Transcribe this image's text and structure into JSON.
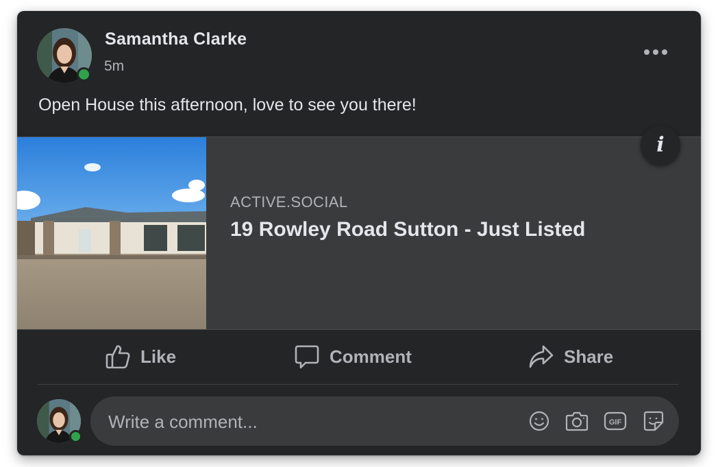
{
  "post": {
    "author_name": "Samantha Clarke",
    "timestamp": "5m",
    "text": "Open House this afternoon, love to see you there!",
    "online_color": "#31a24c"
  },
  "link": {
    "domain": "ACTIVE.SOCIAL",
    "title": "19 Rowley Road Sutton - Just Listed",
    "info_icon": "info-icon"
  },
  "actions": {
    "like_label": "Like",
    "comment_label": "Comment",
    "share_label": "Share"
  },
  "comment": {
    "placeholder": "Write a comment...",
    "icons": [
      "emoji-icon",
      "camera-icon",
      "gif-icon",
      "sticker-icon"
    ]
  },
  "theme": {
    "card_bg": "#242526",
    "surface_bg": "#3a3b3c",
    "text_primary": "#e4e6eb",
    "text_secondary": "#b0b3b8"
  }
}
